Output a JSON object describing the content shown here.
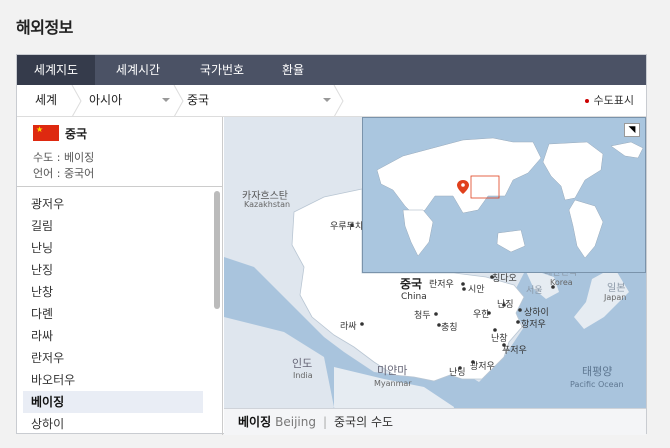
{
  "page_title": "해외정보",
  "tabs": [
    {
      "label": "세계지도",
      "active": true
    },
    {
      "label": "세계시간",
      "active": false
    },
    {
      "label": "국가번호",
      "active": false
    },
    {
      "label": "환율",
      "active": false
    }
  ],
  "breadcrumb": {
    "root": "세계",
    "region": "아시아",
    "country": "중국",
    "capital_toggle": "수도표시"
  },
  "country": {
    "name": "중국",
    "capital_line": "수도 : 베이징",
    "language_line": "언어 : 중국어",
    "flag_colors": {
      "field": "#de2910",
      "star": "#ffde00"
    }
  },
  "cities": [
    "광저우",
    "길림",
    "난닝",
    "난징",
    "난창",
    "다롄",
    "라싸",
    "란저우",
    "바오터우",
    "베이징",
    "상하이"
  ],
  "selected_city": "베이징",
  "map": {
    "labels": {
      "kazakhstan_ko": "카자흐스탄",
      "kazakhstan_en": "Kazakhstan",
      "urumqi": "우루무치",
      "china_ko": "중국",
      "china_en": "China",
      "lanzhou": "란저우",
      "xian": "시안",
      "qingdao": "칭다오",
      "korea_ko": "대한민국",
      "korea_en": "Korea",
      "seoul": "서울",
      "japan_ko": "일본",
      "japan_en": "Japan",
      "nanjing": "난징",
      "shanghai": "상하이",
      "hangzhou": "항저우",
      "wuhan": "우한",
      "chengdu": "청두",
      "chongqing": "충칭",
      "lhasa": "라싸",
      "nanchang": "난창",
      "fuzhou": "푸저우",
      "india_ko": "인도",
      "india_en": "India",
      "myanmar_ko": "미얀마",
      "myanmar_en": "Myanmar",
      "nanning": "난닝",
      "guangzhou": "광저우",
      "pacific_ko": "태평양",
      "pacific_en": "Pacific Ocean"
    },
    "caption": {
      "city_ko": "베이징",
      "city_en": "Beijing",
      "note": "중국의 수도"
    },
    "colors": {
      "ocean": "#a9c4dd",
      "land": "#ffffff",
      "neighbor": "#dfe6ee",
      "marker": "#e0401c"
    }
  }
}
